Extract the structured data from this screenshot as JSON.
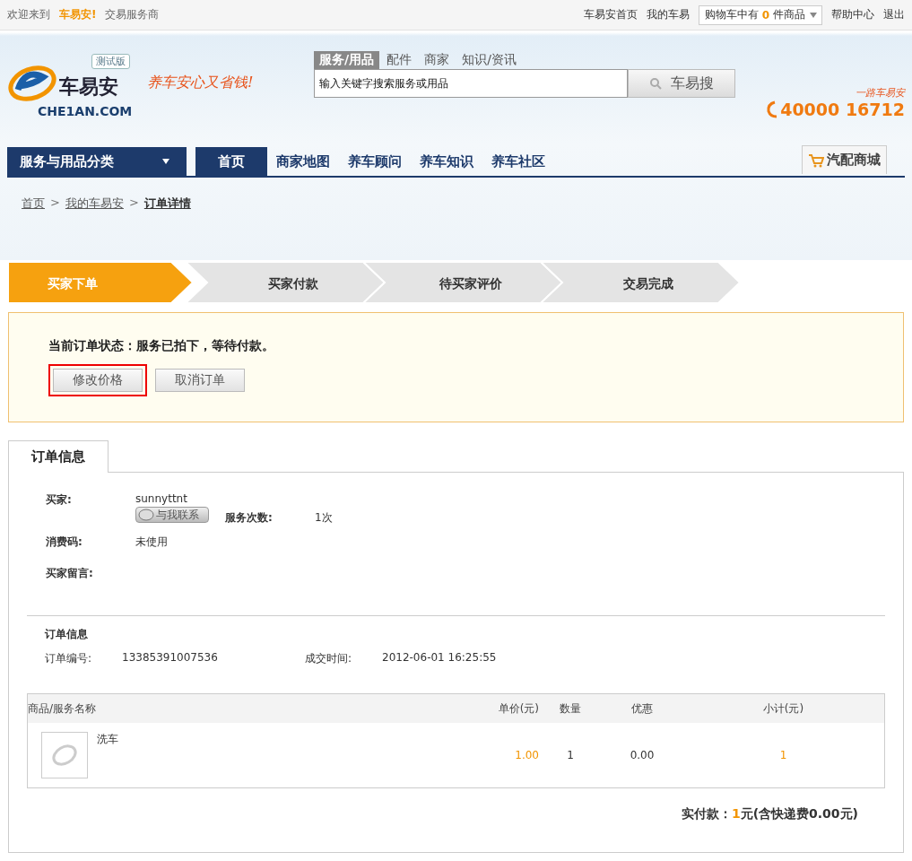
{
  "top_bar": {
    "welcome": "欢迎来到",
    "brand": "车易安!",
    "role": "交易服务商",
    "links": [
      "车易安首页",
      "我的车易"
    ],
    "cart": {
      "prefix": "购物车中有",
      "count": "0",
      "suffix": "件商品"
    },
    "links_after": [
      "帮助中心",
      "退出"
    ]
  },
  "header": {
    "logo": {
      "badge": "测试版",
      "name": "车易安",
      "domain": "CHE1AN.COM"
    },
    "slogan": "养车安心又省钱!",
    "search_tabs": [
      {
        "label": "服务/用品",
        "selected": true
      },
      {
        "label": "配件",
        "selected": false
      },
      {
        "label": "商家",
        "selected": false
      },
      {
        "label": "知识/资讯",
        "selected": false
      }
    ],
    "search": {
      "placeholder": "输入关键字搜索服务或用品",
      "button": "车易搜"
    },
    "hotline": {
      "tagline": "一路车易安",
      "number": "40000 16712"
    }
  },
  "nav": {
    "category": "服务与用品分类",
    "items": [
      {
        "label": "首页",
        "selected": true
      },
      {
        "label": "商家地图",
        "selected": false
      },
      {
        "label": "养车顾问",
        "selected": false
      },
      {
        "label": "养车知识",
        "selected": false
      },
      {
        "label": "养车社区",
        "selected": false
      }
    ],
    "shop": "汽配商城"
  },
  "breadcrumb": [
    {
      "label": "首页",
      "current": false
    },
    {
      "label": "我的车易安",
      "current": false
    },
    {
      "label": "订单详情",
      "current": true
    }
  ],
  "breadcrumb_separator": ">",
  "steps": [
    {
      "label": "买家下单",
      "selected": true
    },
    {
      "label": "买家付款",
      "selected": false
    },
    {
      "label": "待买家评价",
      "selected": false
    },
    {
      "label": "交易完成",
      "selected": false
    }
  ],
  "status": {
    "text": "当前订单状态：服务已拍下，等待付款。",
    "buttons": [
      {
        "label": "修改价格",
        "highlighted": true
      },
      {
        "label": "取消订单",
        "highlighted": false
      }
    ]
  },
  "tab": "订单信息",
  "buyer": {
    "label": "买家:",
    "name": "sunnyttnt",
    "contact": "与我联系",
    "service_label": "服务次数:",
    "service_count": "1次",
    "code_label": "消费码:",
    "code_value": "未使用",
    "message_label": "买家留言:"
  },
  "order": {
    "heading": "订单信息",
    "number_label": "订单编号:",
    "number": "13385391007536",
    "time_label": "成交时间:",
    "time": "2012-06-01 16:25:55"
  },
  "table": {
    "columns": [
      "商品/服务名称",
      "单价(元)",
      "数量",
      "优惠",
      "小计(元)"
    ],
    "rows": [
      {
        "name": "洗车",
        "price": "1.00",
        "quantity": "1",
        "discount": "0.00",
        "subtotal": "1"
      }
    ]
  },
  "total": {
    "label": "实付款：",
    "amount": "1",
    "rest": "元(含快递费0.00元)"
  }
}
